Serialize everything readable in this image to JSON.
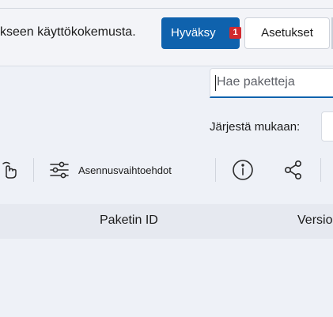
{
  "consent": {
    "text": "kseen käyttökokemusta.",
    "accept_label": "Hyväksy",
    "badge": "1",
    "settings_label": "Asetukset"
  },
  "search": {
    "placeholder": "Hae paketteja"
  },
  "sort": {
    "label": "Järjestä mukaan:"
  },
  "toolbar": {
    "icons": [
      "touch-hand-icon",
      "sliders-icon",
      "info-icon",
      "share-icon"
    ],
    "install_options_label": "Asennusvaihtoehdot"
  },
  "table": {
    "columns": [
      "Paketin ID",
      "Versio"
    ]
  },
  "colors": {
    "accent": "#0f62ad",
    "badge": "#d12a2f",
    "background": "#eef1f7"
  }
}
